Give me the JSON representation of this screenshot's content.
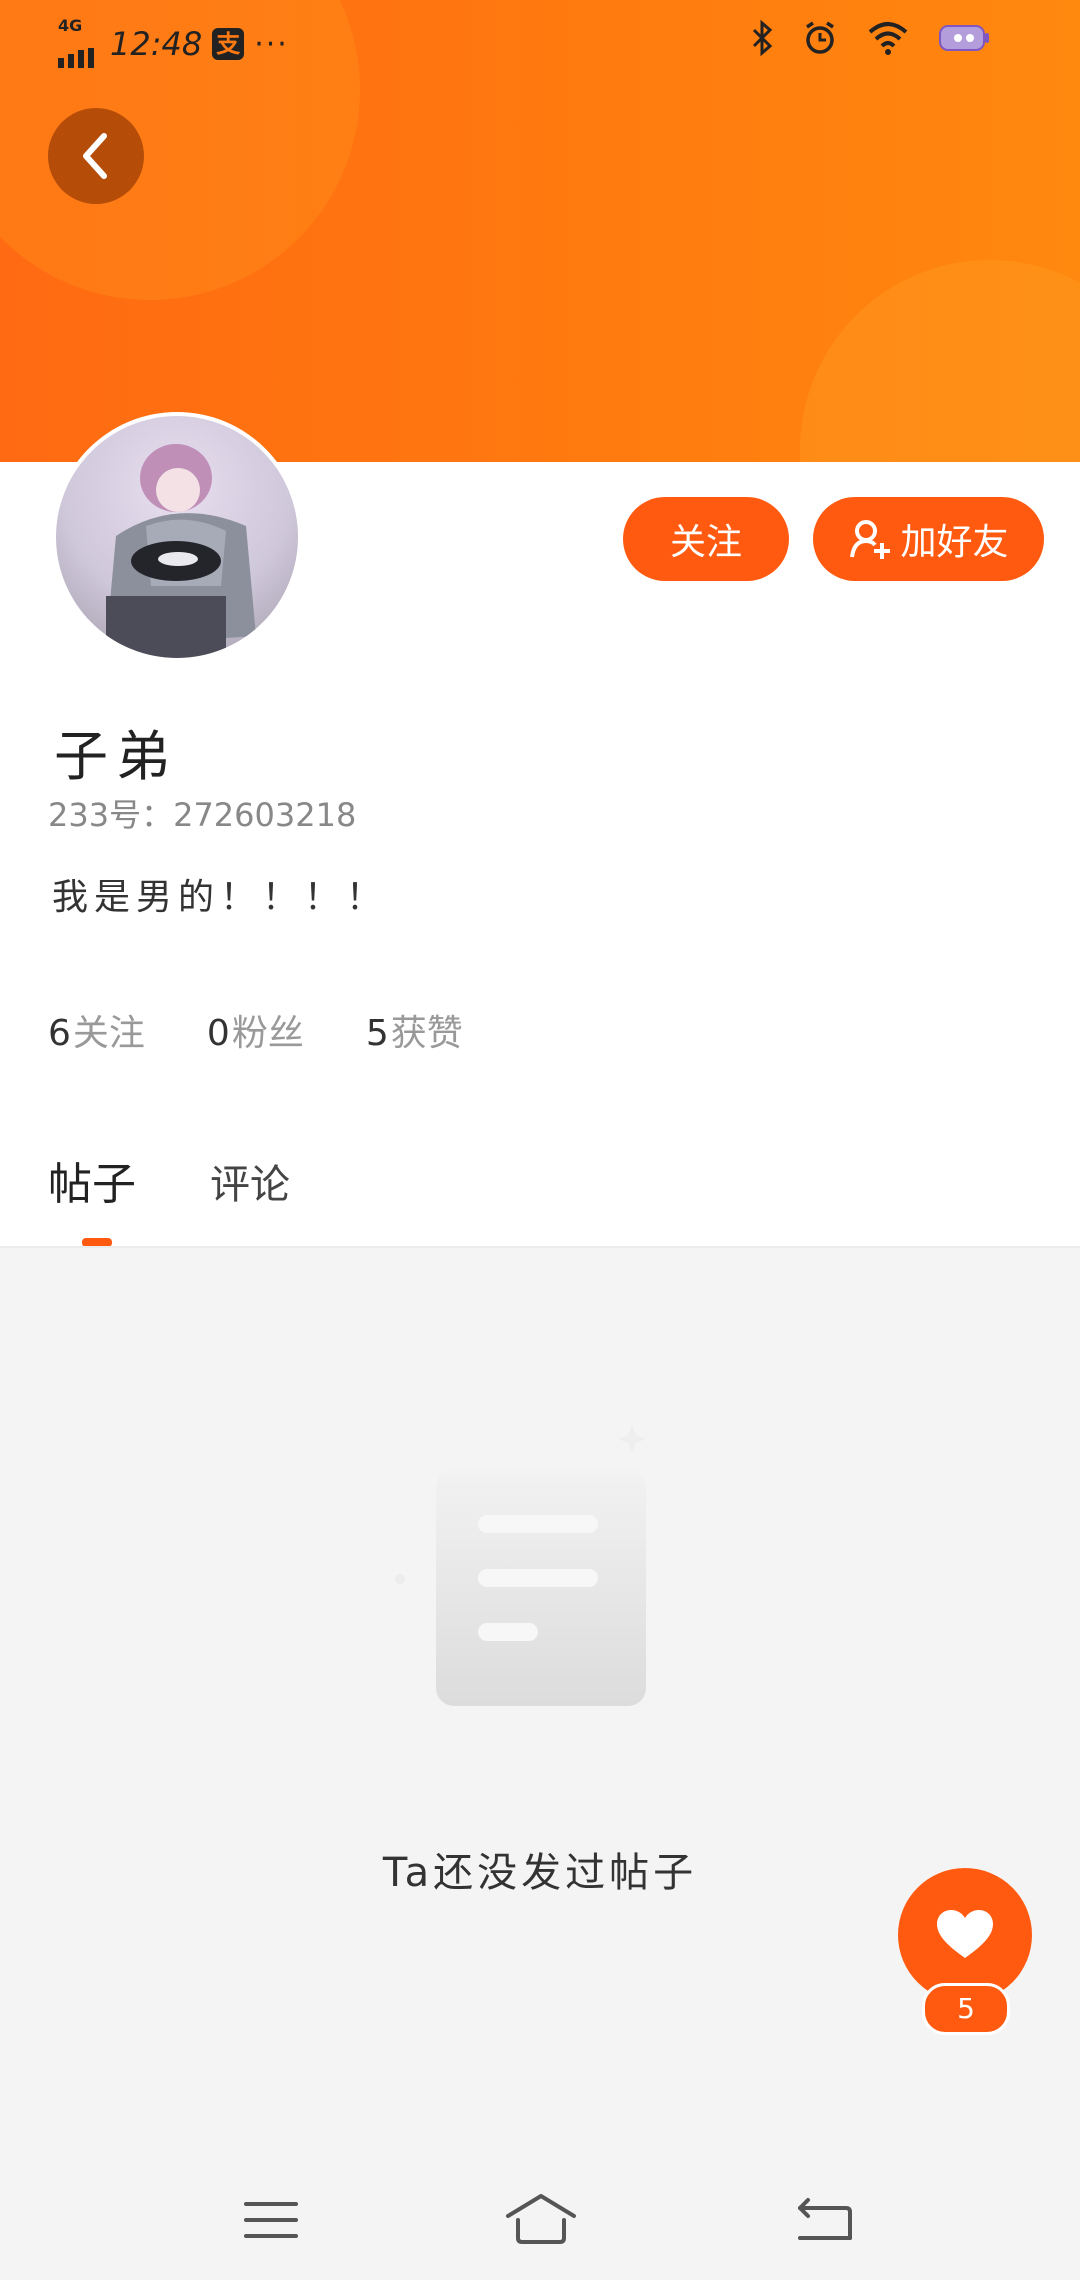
{
  "status_bar": {
    "network": "4G",
    "time": "12:48",
    "pay_badge": "支",
    "more": "···"
  },
  "profile": {
    "nickname": "子弟",
    "id_text": "233号：272603218",
    "bio": "我是男的！！！！",
    "follow_label": "关注",
    "add_friend_label": "加好友",
    "stats": {
      "following_count": "6",
      "following_label": "关注",
      "fans_count": "0",
      "fans_label": "粉丝",
      "likes_count": "5",
      "likes_label": "获赞"
    }
  },
  "tabs": [
    {
      "label": "帖子",
      "active": true
    },
    {
      "label": "评论",
      "active": false
    }
  ],
  "empty_state": {
    "text": "Ta还没发过帖子"
  },
  "like_fab": {
    "count": "5"
  },
  "colors": {
    "accent": "#ff5a10",
    "header_gradient_start": "#ff6a12",
    "header_gradient_end": "#ff880f"
  }
}
